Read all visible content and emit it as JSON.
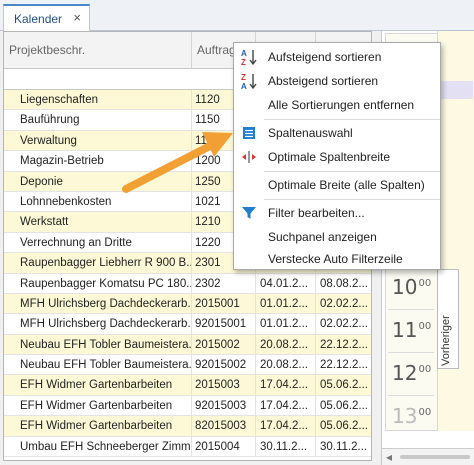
{
  "tab": {
    "label": "Kalender",
    "close_glyph": "×"
  },
  "grid": {
    "headers": [
      "Projektbeschr.",
      "Auftrag N",
      "",
      ""
    ],
    "rows": [
      {
        "cells": [
          "Liegenschaften",
          "1120",
          "",
          ""
        ],
        "shade": "y"
      },
      {
        "cells": [
          "Bauführung",
          "1150",
          "",
          ""
        ],
        "shade": "w"
      },
      {
        "cells": [
          "Verwaltung",
          "1150",
          "",
          ""
        ],
        "shade": "y"
      },
      {
        "cells": [
          "Magazin-Betrieb",
          "1200",
          "",
          ""
        ],
        "shade": "w"
      },
      {
        "cells": [
          "Deponie",
          "1250",
          "",
          ""
        ],
        "shade": "y"
      },
      {
        "cells": [
          "Lohnnebenkosten",
          "1021",
          "",
          ""
        ],
        "shade": "w"
      },
      {
        "cells": [
          "Werkstatt",
          "1210",
          "",
          ""
        ],
        "shade": "y"
      },
      {
        "cells": [
          "Verrechnung an Dritte",
          "1220",
          "",
          ""
        ],
        "shade": "w"
      },
      {
        "cells": [
          "Raupenbagger Liebherr R 900 B...",
          "2301",
          "",
          ""
        ],
        "shade": "y"
      },
      {
        "cells": [
          "Raupenbagger Komatsu PC 180...",
          "2302",
          "04.01.2...",
          "08.08.2..."
        ],
        "shade": "w"
      },
      {
        "cells": [
          "MFH Ulrichsberg Dachdeckerarb...",
          "2015001",
          "01.01.2...",
          "02.02.2..."
        ],
        "shade": "y"
      },
      {
        "cells": [
          "MFH Ulrichsberg Dachdeckerarb...",
          "92015001",
          "01.01.2...",
          "02.02.2..."
        ],
        "shade": "w"
      },
      {
        "cells": [
          "Neubau EFH Tobler Baumeistera...",
          "2015002",
          "20.08.2...",
          "22.12.2..."
        ],
        "shade": "y"
      },
      {
        "cells": [
          "Neubau EFH Tobler Baumeistera...",
          "92015002",
          "20.08.2...",
          "22.12.2..."
        ],
        "shade": "w"
      },
      {
        "cells": [
          "EFH Widmer Gartenbarbeiten",
          "2015003",
          "17.04.2...",
          "05.06.2..."
        ],
        "shade": "y"
      },
      {
        "cells": [
          "EFH Widmer Gartenbarbeiten",
          "92015003",
          "17.04.2...",
          "05.06.2..."
        ],
        "shade": "w"
      },
      {
        "cells": [
          "EFH Widmer Gartenbarbeiten",
          "82015003",
          "17.04.2...",
          "05.06.2..."
        ],
        "shade": "y"
      },
      {
        "cells": [
          "Umbau EFH Schneeberger Zimm...",
          "2015004",
          "30.11.2...",
          "30.11.2..."
        ],
        "shade": "w"
      }
    ]
  },
  "menu": {
    "items": [
      {
        "label": "Aufsteigend sortieren",
        "icon": "sort-ascending-icon"
      },
      {
        "label": "Absteigend sortieren",
        "icon": "sort-descending-icon"
      },
      {
        "label": "Alle Sortierungen entfernen",
        "icon": ""
      },
      {
        "label": "Spaltenauswahl",
        "icon": "column-chooser-icon"
      },
      {
        "label": "Optimale Spaltenbreite",
        "icon": "best-fit-icon"
      },
      {
        "label": "Optimale Breite (alle Spalten)",
        "icon": ""
      },
      {
        "label": "Filter bearbeiten...",
        "icon": "filter-icon"
      },
      {
        "label": "Suchpanel anzeigen",
        "icon": ""
      },
      {
        "label": "Verstecke Auto Filterzeile",
        "icon": ""
      }
    ],
    "icon_glyphs": {
      "sort_az_top": "A",
      "sort_az_bottom": "Z",
      "best_fit": "+|+"
    }
  },
  "calendar": {
    "hours": [
      {
        "hour": "10",
        "minutes": "00"
      },
      {
        "hour": "11",
        "minutes": "00"
      },
      {
        "hour": "12",
        "minutes": "00"
      },
      {
        "hour": "13",
        "minutes": "00"
      }
    ],
    "vertical_label": "Vorheriger",
    "scroll_left_glyph": "◂"
  },
  "colors": {
    "row_yellow": "#fdf9d6",
    "accent_blue": "#1f7ed0",
    "arrow_orange": "#f2a033",
    "sort_red": "#d53b35"
  }
}
